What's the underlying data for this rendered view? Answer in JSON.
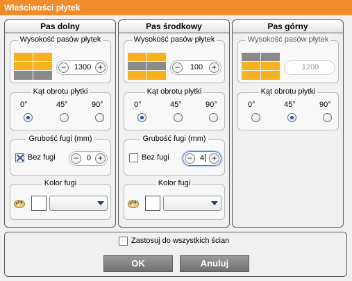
{
  "window": {
    "title": "Właściwości płytek"
  },
  "columns": [
    {
      "title": "Pas dolny",
      "height_group": {
        "title": "Wysokość pasów płytek",
        "value": "1300",
        "enabled": true,
        "highlight": "bottom"
      },
      "angle_group": {
        "title": "Kąt obrotu płytki",
        "options": [
          "0°",
          "45°",
          "90°"
        ],
        "selected": "0°"
      },
      "grout_group": {
        "title": "Grubość fugi (mm)",
        "checkbox_label": "Bez fugi",
        "checked": true,
        "value": "0"
      },
      "color_group": {
        "title": "Kolor fugi",
        "color": "#ffffff"
      }
    },
    {
      "title": "Pas środkowy",
      "height_group": {
        "title": "Wysokość pasów płytek",
        "value": "100",
        "enabled": true,
        "highlight": "middle"
      },
      "angle_group": {
        "title": "Kąt obrotu płytki",
        "options": [
          "0°",
          "45°",
          "90°"
        ],
        "selected": "0°"
      },
      "grout_group": {
        "title": "Grubość fugi (mm)",
        "checkbox_label": "Bez fugi",
        "checked": false,
        "value": "4"
      },
      "color_group": {
        "title": "Kolor fugi",
        "color": "#ffffff"
      }
    },
    {
      "title": "Pas górny",
      "height_group": {
        "title": "Wysokość pasów płytek",
        "value": "1200",
        "enabled": false,
        "highlight": "top"
      },
      "angle_group": {
        "title": "Kąt obrotu płytki",
        "options": [
          "0°",
          "45°",
          "90°"
        ],
        "selected": "45°"
      }
    }
  ],
  "apply_all": {
    "label": "Zastosuj do wszystkich ścian",
    "checked": false
  },
  "buttons": {
    "ok": "OK",
    "cancel": "Anuluj"
  },
  "colors": {
    "title_bar": "#f08c2c",
    "tile": "#f6b020",
    "tile_highlight": "#8a8a8a",
    "button": "#808080"
  },
  "icons": {
    "minus": "−",
    "plus": "+",
    "palette": "palette-icon",
    "dropdown": "chevron-down-icon"
  }
}
